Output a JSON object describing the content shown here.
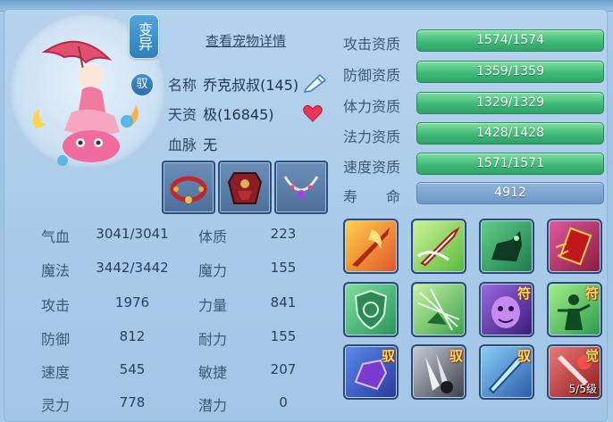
{
  "actions": {
    "transform_label": "变异",
    "ride_label": "驭",
    "detail_link": "查看宠物详情"
  },
  "info": {
    "name_label": "名称",
    "name_value": "乔克叔叔(145)",
    "talent_label": "天资",
    "talent_value": "极(16845)",
    "bloodline_label": "血脉",
    "bloodline_value": "无"
  },
  "equipment": [
    {
      "icon": "bracelet-icon"
    },
    {
      "icon": "armor-icon"
    },
    {
      "icon": "necklace-icon"
    }
  ],
  "stats": [
    {
      "label": "气血",
      "value": "3041/3041",
      "label2": "体质",
      "value2": "223"
    },
    {
      "label": "魔法",
      "value": "3442/3442",
      "label2": "魔力",
      "value2": "155"
    },
    {
      "label": "攻击",
      "value": "1976",
      "label2": "力量",
      "value2": "841"
    },
    {
      "label": "防御",
      "value": "812",
      "label2": "耐力",
      "value2": "155"
    },
    {
      "label": "速度",
      "value": "545",
      "label2": "敏捷",
      "value2": "207"
    },
    {
      "label": "灵力",
      "value": "778",
      "label2": "潜力",
      "value2": "0"
    }
  ],
  "aptitudes": [
    {
      "label": "攻击资质",
      "value": "1574/1574",
      "fill": 1.0
    },
    {
      "label": "防御资质",
      "value": "1359/1359",
      "fill": 1.0
    },
    {
      "label": "体力资质",
      "value": "1329/1329",
      "fill": 1.0
    },
    {
      "label": "法力资质",
      "value": "1428/1428",
      "fill": 1.0
    },
    {
      "label": "速度资质",
      "value": "1571/1571",
      "fill": 1.0
    },
    {
      "label": "寿　　命",
      "value": "4912"
    }
  ],
  "skills": [
    {
      "icon": "flaming-sword-icon",
      "tag": ""
    },
    {
      "icon": "sword-slash-icon",
      "tag": ""
    },
    {
      "icon": "green-beast-icon",
      "tag": ""
    },
    {
      "icon": "red-seal-icon",
      "tag": ""
    },
    {
      "icon": "shield-icon",
      "tag": ""
    },
    {
      "icon": "green-burst-icon",
      "tag": ""
    },
    {
      "icon": "purple-ghost-icon",
      "tag": "符"
    },
    {
      "icon": "green-figure-icon",
      "tag": "符"
    },
    {
      "icon": "purple-fist-icon",
      "tag": "驭"
    },
    {
      "icon": "silver-claw-icon",
      "tag": "驭"
    },
    {
      "icon": "blue-blade-icon",
      "tag": "驭"
    },
    {
      "icon": "red-awaken-icon",
      "tag": "觉",
      "level": "5/5级"
    }
  ],
  "colors": {
    "bar_green": "#3fb978",
    "bar_blue": "#6f98c7",
    "panel_bg": "#a9cbea"
  }
}
